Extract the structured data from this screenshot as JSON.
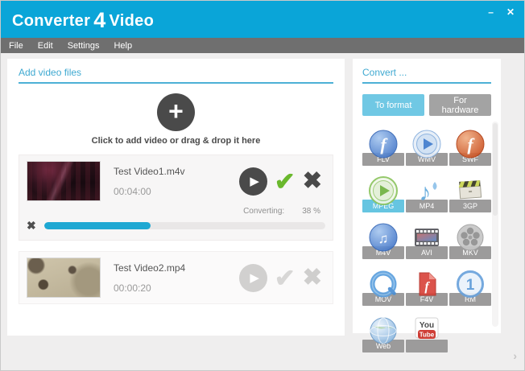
{
  "window": {
    "title_part1": "Converter",
    "title_part2": "4",
    "title_part3": "Video",
    "minimize_glyph": "–",
    "close_glyph": "✕"
  },
  "menu": {
    "items": [
      "File",
      "Edit",
      "Settings",
      "Help"
    ]
  },
  "glyphs": {
    "play": "▶",
    "check": "✔",
    "remove": "✖",
    "cancel": "✖",
    "expand": "›"
  },
  "add_panel": {
    "header": "Add video files",
    "add_glyph": "+",
    "drop_hint": "Click to add video or drag & drop it here",
    "videos": [
      {
        "name": "Test Video1.m4v",
        "duration": "00:04:00",
        "status_label": "Converting:",
        "progress_text": "38 %",
        "progress_value": 38
      },
      {
        "name": "Test Video2.mp4",
        "duration": "00:00:20"
      }
    ]
  },
  "convert_panel": {
    "header": "Convert ...",
    "buttons": [
      {
        "label": "To format"
      },
      {
        "label": "For hardware"
      }
    ],
    "formats": [
      {
        "label": "FLV",
        "glyph": "f"
      },
      {
        "label": "WMV"
      },
      {
        "label": "SWF",
        "glyph": "f"
      },
      {
        "label": "MPEG",
        "selected": true
      },
      {
        "label": "MP4",
        "glyph": "♪"
      },
      {
        "label": "3GP"
      },
      {
        "label": "M4V",
        "glyph": "♫"
      },
      {
        "label": "AVI"
      },
      {
        "label": "MKV"
      },
      {
        "label": "MOV"
      },
      {
        "label": "F4V",
        "glyph": "f"
      },
      {
        "label": "RM",
        "glyph": "1"
      },
      {
        "label": "Web"
      },
      {
        "label": "",
        "icon_text_top": "You",
        "icon_text_bottom": "Tube"
      }
    ],
    "colors": {
      "titlebar": "#0aa5d8",
      "menubar": "#6f6f6f",
      "accent": "#3fa9d1",
      "progress_fill": "#1fa8d3",
      "button_active": "#70c8e4",
      "button_inactive": "#a3a3a3",
      "selected_label": "#66c5e1",
      "check_green": "#6ab82d"
    }
  }
}
